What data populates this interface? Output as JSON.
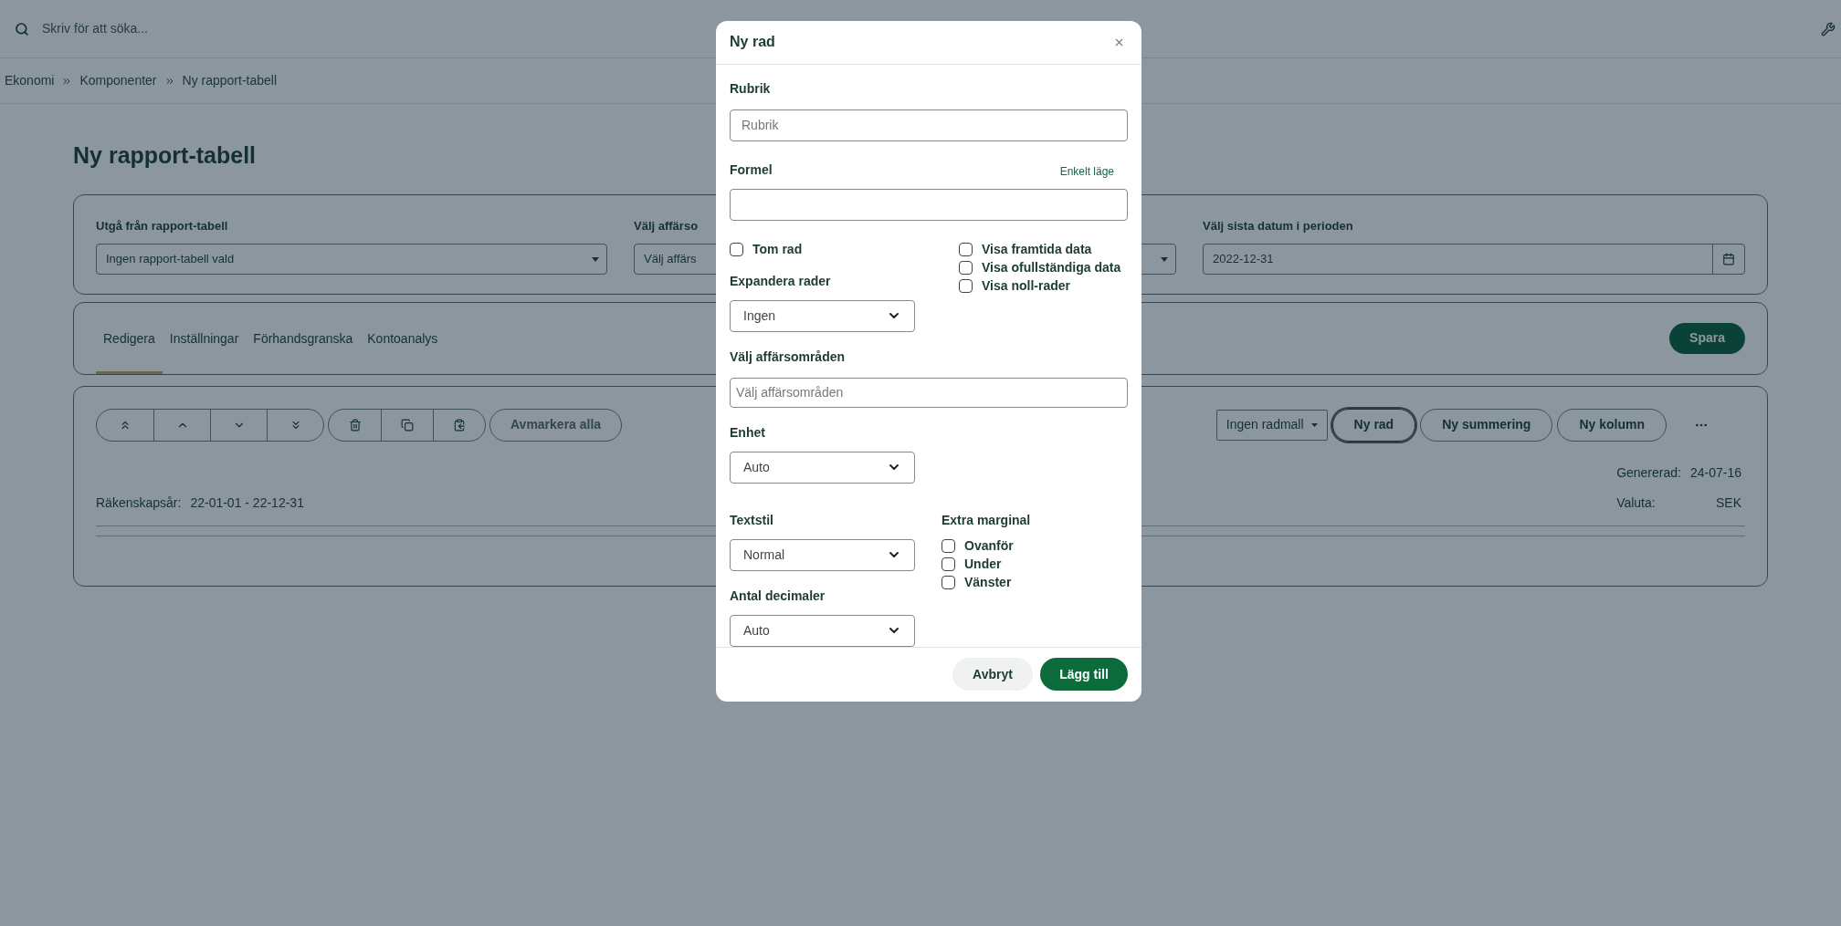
{
  "search": {
    "placeholder": "Skriv för att söka..."
  },
  "breadcrumb": [
    "Ekonomi",
    "Komponenter",
    "Ny rapport-tabell"
  ],
  "page_title": "Ny rapport-tabell",
  "filters": [
    {
      "kind": "select",
      "label": "Utgå från rapport-tabell",
      "value": "Ingen rapport-tabell vald"
    },
    {
      "kind": "select",
      "label": "Välj affärso",
      "value": "Välj affärs"
    },
    {
      "kind": "date",
      "label": "Välj sista datum i perioden",
      "value": "2022-12-31"
    }
  ],
  "tabs": [
    {
      "label": "Redigera",
      "selected": true
    },
    {
      "label": "Inställningar",
      "selected": false
    },
    {
      "label": "Förhandsgranska",
      "selected": false
    },
    {
      "label": "Kontoanalys",
      "selected": false
    }
  ],
  "save_button": "Spara",
  "toolbar": {
    "deselect_button": "Avmarkera alla",
    "template_select": "Ingen radmall",
    "buttons": [
      {
        "label": "Ny rad",
        "focused": true
      },
      {
        "label": "Ny summering",
        "focused": false
      },
      {
        "label": "Ny kolumn",
        "focused": false
      }
    ]
  },
  "report_info": {
    "fiscal_year_label": "Räkenskapsår:",
    "fiscal_year": "22-01-01 - 22-12-31",
    "generated_label": "Genererad:",
    "generated": "24-07-16",
    "currency_label": "Valuta:",
    "currency": "SEK"
  },
  "dialog": {
    "title": "Ny rad",
    "heading_field": {
      "label": "Rubrik",
      "placeholder": "Rubrik"
    },
    "formula_field": {
      "label": "Formel",
      "mode_link": "Enkelt läge"
    },
    "empty_row": {
      "label": "Tom rad",
      "checked": false
    },
    "display_options": [
      {
        "label": "Visa framtida data",
        "checked": false
      },
      {
        "label": "Visa ofullständiga data",
        "checked": false
      },
      {
        "label": "Visa noll-rader",
        "checked": false
      }
    ],
    "expand_rows": {
      "label": "Expandera rader",
      "value": "Ingen"
    },
    "business_areas": {
      "label": "Välj affärsområden",
      "placeholder": "Välj affärsområden"
    },
    "unit": {
      "label": "Enhet",
      "value": "Auto"
    },
    "text_style": {
      "label": "Textstil",
      "value": "Normal"
    },
    "decimals": {
      "label": "Antal decimaler",
      "value": "Auto"
    },
    "extra_margin": {
      "label": "Extra marginal",
      "options": [
        {
          "label": "Ovanför",
          "checked": false
        },
        {
          "label": "Under",
          "checked": false
        },
        {
          "label": "Vänster",
          "checked": false
        }
      ]
    },
    "cancel_button": "Avbryt",
    "add_button": "Lägg till"
  }
}
